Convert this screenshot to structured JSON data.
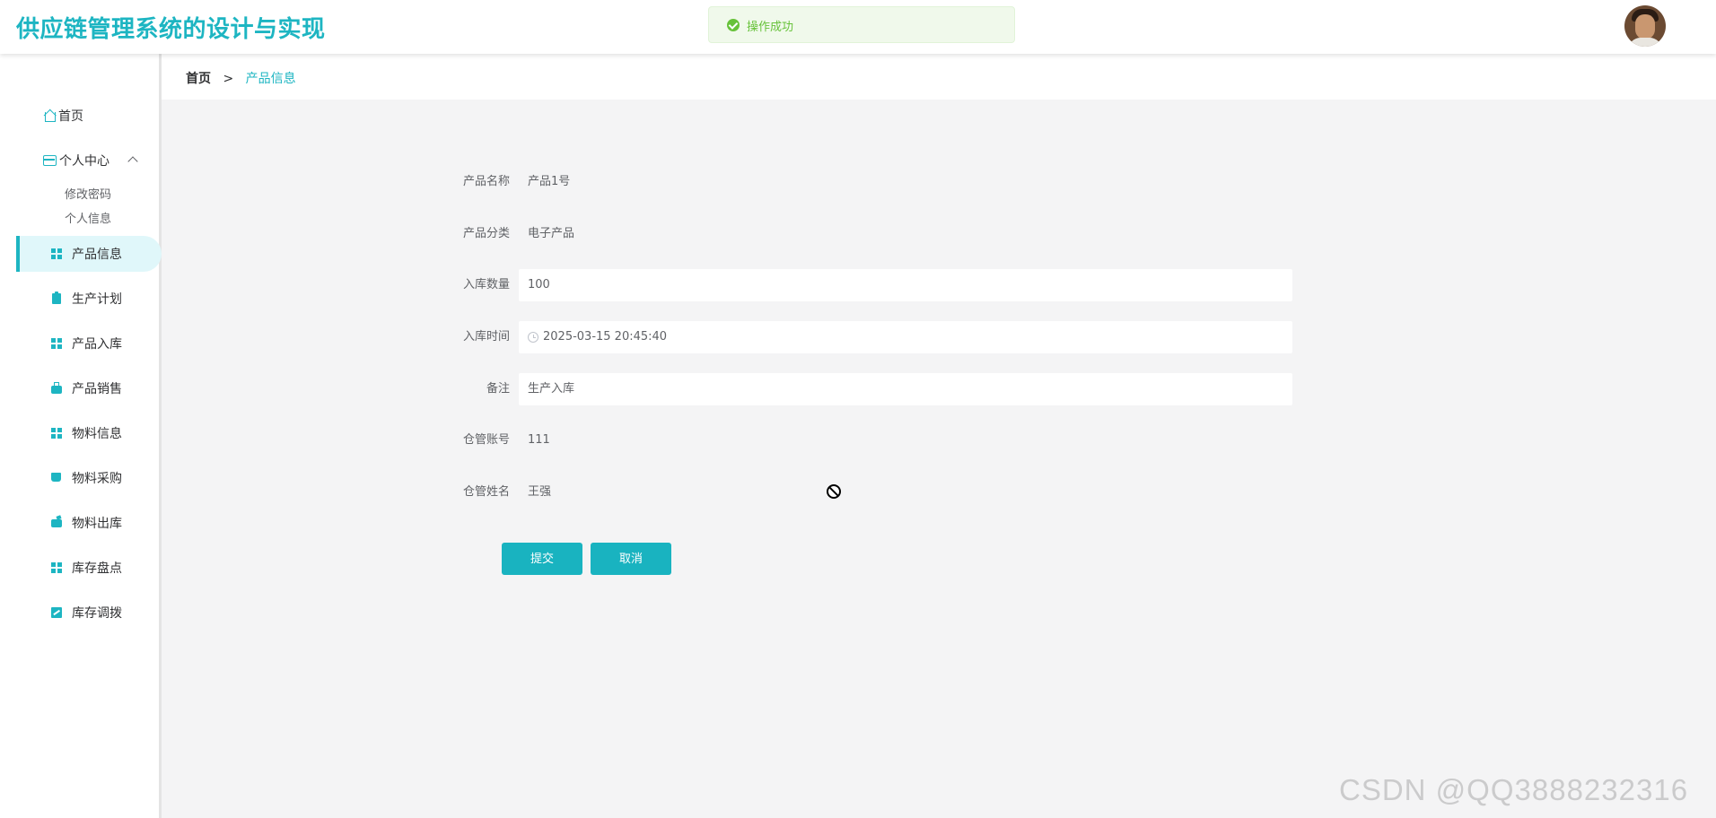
{
  "header": {
    "title": "供应链管理系统的设计与实现",
    "avatar": "user-avatar"
  },
  "toast": {
    "message": "操作成功",
    "icon": "success-check-icon",
    "color": "#67c23a"
  },
  "sidebar": {
    "home": "首页",
    "personal_center": "个人中心",
    "personal_sub": [
      "修改密码",
      "个人信息"
    ],
    "menu": [
      {
        "label": "产品信息",
        "icon": "grid-icon",
        "active": true
      },
      {
        "label": "生产计划",
        "icon": "clipboard-icon"
      },
      {
        "label": "产品入库",
        "icon": "grid-icon"
      },
      {
        "label": "产品销售",
        "icon": "briefcase-icon"
      },
      {
        "label": "物料信息",
        "icon": "grid-icon"
      },
      {
        "label": "物料采购",
        "icon": "book-icon"
      },
      {
        "label": "物料出库",
        "icon": "wallet-icon"
      },
      {
        "label": "库存盘点",
        "icon": "grid-icon"
      },
      {
        "label": "库存调拨",
        "icon": "chart-icon"
      }
    ]
  },
  "breadcrumb": {
    "home": "首页",
    "separator": ">",
    "current": "产品信息"
  },
  "form": {
    "product_name": {
      "label": "产品名称",
      "value": "产品1号"
    },
    "product_category": {
      "label": "产品分类",
      "value": "电子产品"
    },
    "stock_quantity": {
      "label": "入库数量",
      "value": "100"
    },
    "stock_time": {
      "label": "入库时间",
      "value": "2025-03-15 20:45:40"
    },
    "remark": {
      "label": "备注",
      "value": "生产入库"
    },
    "keeper_account": {
      "label": "仓管账号",
      "value": "111"
    },
    "keeper_name": {
      "label": "仓管姓名",
      "value": "王强"
    },
    "submit_label": "提交",
    "cancel_label": "取消"
  },
  "watermark": "CSDN @QQ3888232316",
  "colors": {
    "accent": "#1db5c2",
    "background": "#f4f4f5"
  }
}
